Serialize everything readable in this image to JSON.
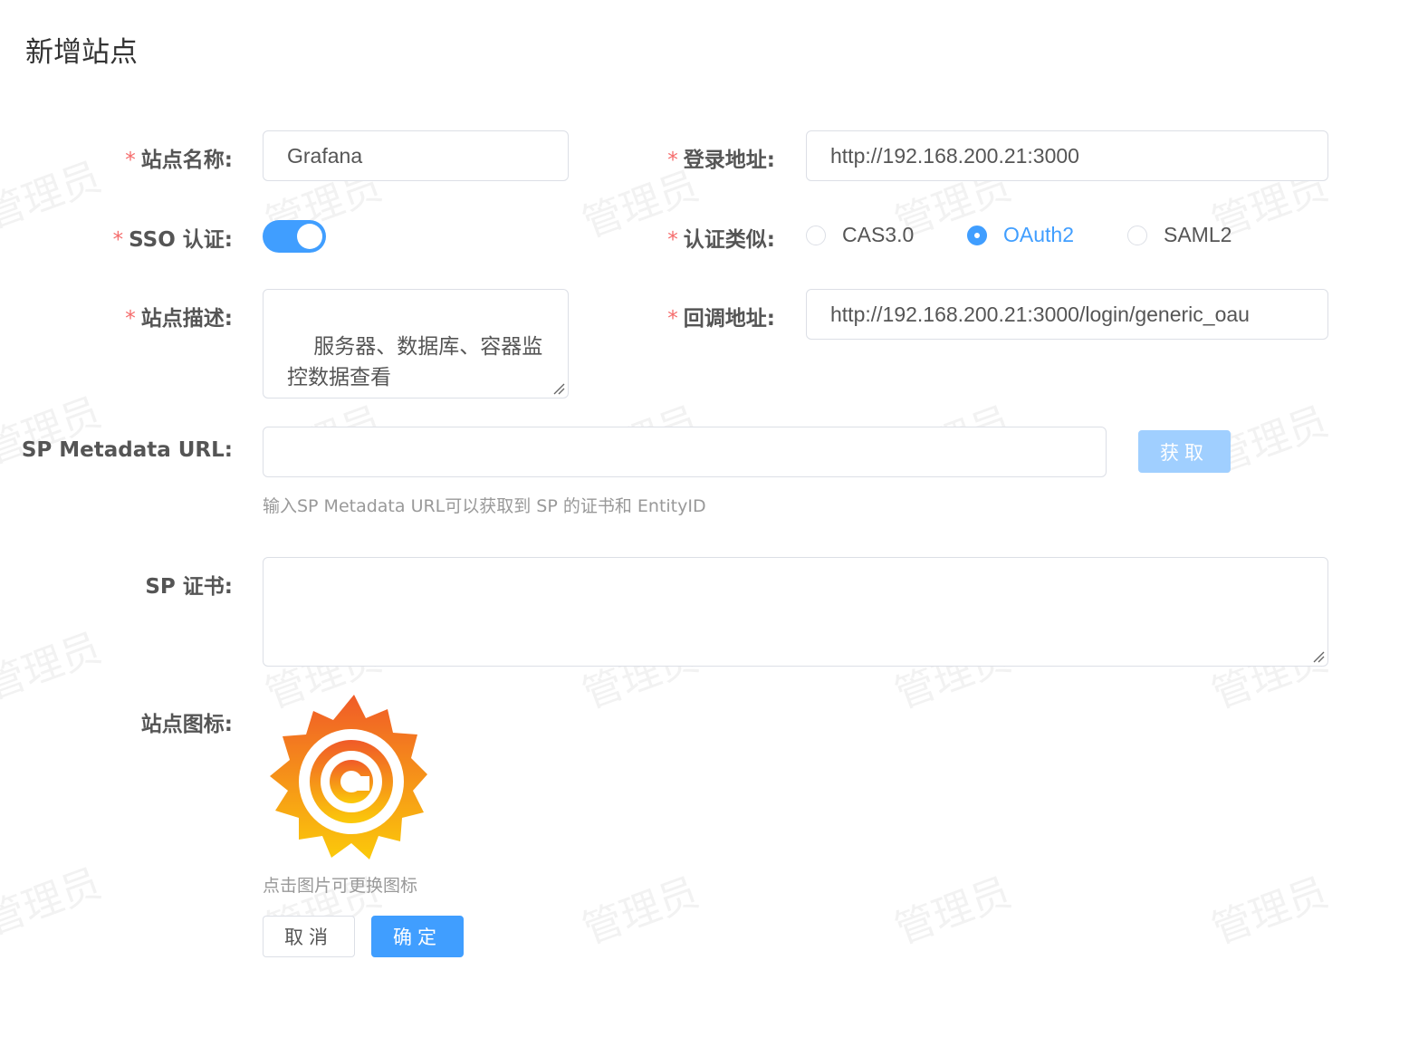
{
  "page": {
    "title": "新增站点",
    "watermark": "管理员"
  },
  "form": {
    "site_name": {
      "label": "站点名称:",
      "value": "Grafana",
      "required": true
    },
    "login_url": {
      "label": "登录地址:",
      "value": "http://192.168.200.21:3000",
      "required": true
    },
    "sso": {
      "label": "SSO 认证:",
      "enabled": true,
      "required": true
    },
    "auth_type": {
      "label": "认证类似:",
      "required": true,
      "options": [
        "CAS3.0",
        "OAuth2",
        "SAML2"
      ],
      "selected": "OAuth2"
    },
    "site_desc": {
      "label": "站点描述:",
      "value": "服务器、数据库、容器监控数据查看",
      "required": true
    },
    "callback_url": {
      "label": "回调地址:",
      "value": "http://192.168.200.21:3000/login/generic_oau",
      "required": true
    },
    "sp_metadata": {
      "label": "SP Metadata URL:",
      "value": "",
      "fetch_label": "获取",
      "hint": "输入SP Metadata URL可以获取到 SP 的证书和 EntityID"
    },
    "sp_cert": {
      "label": "SP 证书:",
      "value": ""
    },
    "site_icon": {
      "label": "站点图标:",
      "icon": "grafana-logo",
      "hint": "点击图片可更换图标"
    }
  },
  "actions": {
    "cancel_label": "取消",
    "confirm_label": "确定"
  },
  "colors": {
    "primary": "#409eff",
    "primary_light": "#a0cfff",
    "required": "#f56c6c",
    "border": "#dcdfe6"
  }
}
